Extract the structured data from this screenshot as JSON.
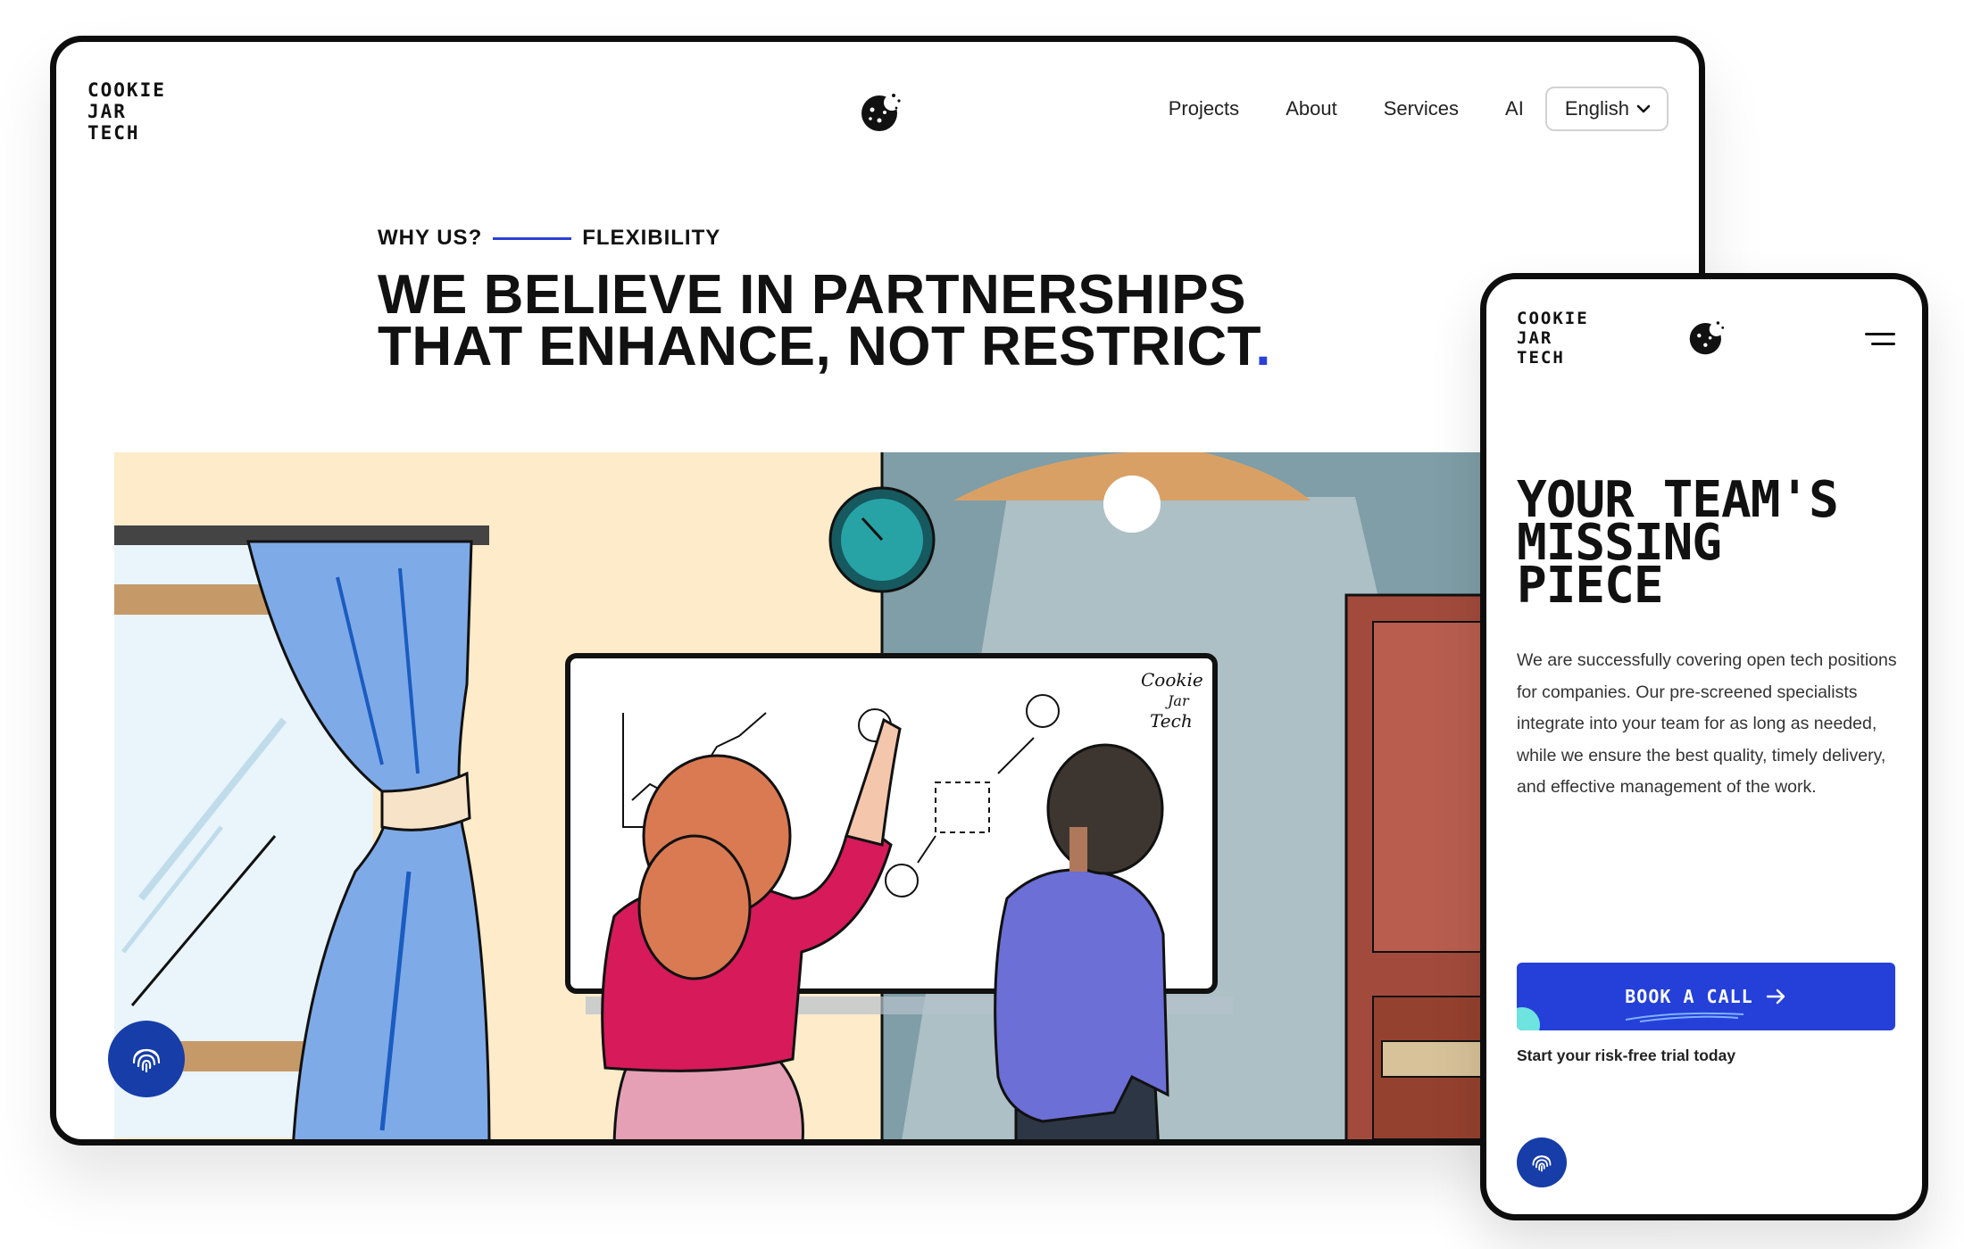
{
  "desktop": {
    "logo_lines": [
      "COOKIE",
      "JAR",
      "TECH"
    ],
    "nav": {
      "projects": "Projects",
      "about": "About",
      "services": "Services",
      "ai": "AI",
      "language": "English"
    },
    "eyebrow": {
      "left": "WHY US?",
      "right": "FLEXIBILITY"
    },
    "headline": {
      "line1": "WE BELIEVE IN PARTNERSHIPS",
      "line2": "THAT ENHANCE, NOT RESTRICT",
      "period": "."
    },
    "whiteboard_signature": [
      "Cookie",
      "Jar",
      "Tech"
    ]
  },
  "mobile": {
    "logo_lines": [
      "COOKIE",
      "JAR",
      "TECH"
    ],
    "title_lines": [
      "YOUR TEAM'S",
      "MISSING",
      "PIECE"
    ],
    "body": "We are successfully covering open tech positions for companies. Our pre-screened specialists integrate into your team for as long as needed, while we ensure the best quality, timely delivery, and effective management of the work.",
    "cta_label": "BOOK A CALL",
    "cta_subtext": "Start your risk-free trial today"
  },
  "colors": {
    "accent": "#2540d9",
    "fingerprint_button": "#163da8",
    "frame": "#0d0d0d"
  },
  "icons": [
    "cookie-logo-icon",
    "chevron-down-icon",
    "fingerprint-icon",
    "hamburger-menu-icon",
    "arrow-right-icon"
  ]
}
